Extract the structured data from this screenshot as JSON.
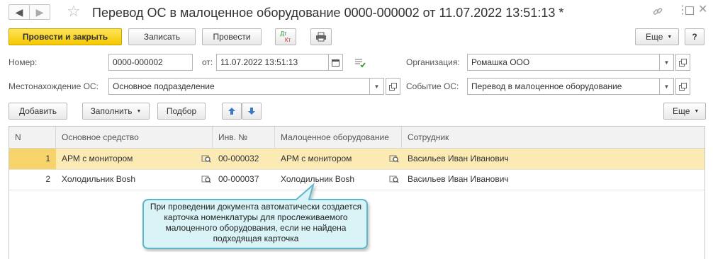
{
  "window": {
    "title": "Перевод ОС в малоценное оборудование 0000-000002 от 11.07.2022 13:51:13 *"
  },
  "toolbar": {
    "post_and_close": "Провести и закрыть",
    "save": "Записать",
    "post": "Провести",
    "dtkt_top": "Дт",
    "dtkt_bottom": "Кт",
    "more": "Еще",
    "help": "?"
  },
  "form": {
    "number_label": "Номер:",
    "number_value": "0000-000002",
    "date_label": "от:",
    "date_value": "11.07.2022 13:51:13",
    "org_label": "Организация:",
    "org_value": "Ромашка ООО",
    "location_label": "Местонахождение ОС:",
    "location_value": "Основное подразделение",
    "event_label": "Событие ОС:",
    "event_value": "Перевод в малоценное оборудование"
  },
  "table_toolbar": {
    "add": "Добавить",
    "fill": "Заполнить",
    "select": "Подбор",
    "more": "Еще"
  },
  "table": {
    "columns": [
      "N",
      "Основное средство",
      "Инв. №",
      "Малоценное оборудование",
      "Сотрудник"
    ],
    "rows": [
      {
        "n": "1",
        "asset": "АРМ с монитором",
        "inv": "00-000032",
        "equipment": "АРМ с монитором",
        "employee": "Васильев Иван Иванович"
      },
      {
        "n": "2",
        "asset": "Холодильник Bosh",
        "inv": "00-000037",
        "equipment": "Холодильник Bosh",
        "employee": "Васильев Иван Иванович"
      }
    ]
  },
  "callout": {
    "text": "При проведении документа автоматически создается карточка номенклатуры для прослеживаемого малоценного оборудования, если не найдена подходящая карточка"
  },
  "colors": {
    "accent": "#f5c800",
    "row_selected": "#fbeab3",
    "callout_bg": "#d9f3f7",
    "callout_border": "#5bb8c9"
  }
}
